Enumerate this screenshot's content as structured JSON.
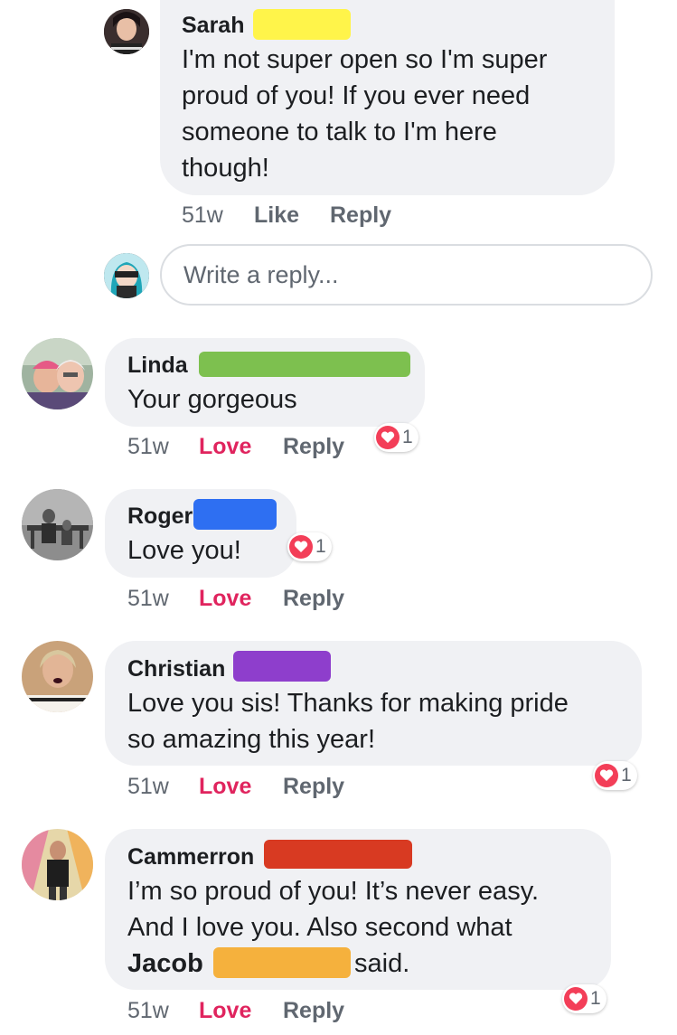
{
  "comments": [
    {
      "name": "Sarah",
      "lines": [
        "I'm not super open so I'm super",
        "proud of you! If you ever need",
        "someone to talk to I'm here",
        "though!"
      ],
      "time": "51w",
      "action": "Like",
      "reply": "Reply",
      "redaction_color": "#fff44a"
    },
    {
      "name": "Linda",
      "lines": [
        "Your gorgeous"
      ],
      "time": "51w",
      "action": "Love",
      "reply": "Reply",
      "reaction_count": "1",
      "redaction_color": "#7dc04f"
    },
    {
      "name": "Roger",
      "lines": [
        "Love you!"
      ],
      "time": "51w",
      "action": "Love",
      "reply": "Reply",
      "reaction_count": "1",
      "redaction_color": "#2e6ff2"
    },
    {
      "name": "Christian",
      "lines": [
        "Love you sis! Thanks for making pride",
        "so amazing this year!"
      ],
      "time": "51w",
      "action": "Love",
      "reply": "Reply",
      "reaction_count": "1",
      "redaction_color": "#8e3ecc"
    },
    {
      "name": "Cammerron",
      "lines": [
        "I’m so proud of you! It’s never easy.",
        "And I love you. Also second what"
      ],
      "mention": "Jacob",
      "mention_suffix": "said.",
      "time": "51w",
      "action": "Love",
      "reply": "Reply",
      "reaction_count": "1",
      "redaction_color": "#d83a22",
      "mention_redaction_color": "#f5b13d"
    }
  ],
  "reply_input": {
    "placeholder": "Write a reply..."
  },
  "colors": {
    "bubble": "#f0f1f4",
    "love": "#e0245e",
    "heart": "#f33e58",
    "meta": "#606770"
  }
}
